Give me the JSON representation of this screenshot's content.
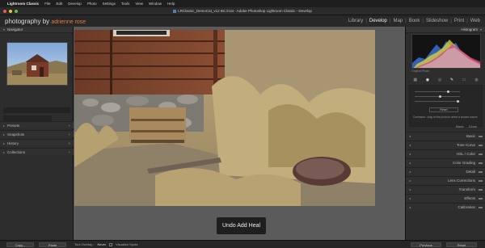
{
  "menubar": {
    "items": [
      "Lightroom Classic",
      "File",
      "Edit",
      "Develop",
      "Photo",
      "Settings",
      "Tools",
      "View",
      "Window",
      "Help"
    ]
  },
  "window": {
    "title": "LRClassic_DemoCat_v12 BC.lrcat - Adobe Photoshop Lightroom Classic - Develop"
  },
  "identity": {
    "brand_main": "photography by",
    "brand_by": "adrienne rose"
  },
  "modules": {
    "items": [
      "Library",
      "Develop",
      "Map",
      "Book",
      "Slideshow",
      "Print",
      "Web"
    ],
    "active": "Develop"
  },
  "left_panel": {
    "navigator_label": "Navigator",
    "sections": [
      "Presets",
      "Snapshots",
      "History",
      "Collections"
    ],
    "copy_button": "Copy...",
    "paste_button": "Paste"
  },
  "center": {
    "toast": "Undo Add Heal"
  },
  "right_panel": {
    "histogram_label": "Histogram",
    "original_photo_label": "Original Photo",
    "tool_reset_button": "Reset",
    "hint_text": "Command - drag on the photo to select a custom source",
    "basic_closed_labels": [
      "Basic",
      "Close"
    ],
    "sections": [
      "Basic",
      "Tone Curve",
      "HSL / Color",
      "Color Grading",
      "Detail",
      "Lens Corrections",
      "Transform",
      "Effects",
      "Calibration"
    ],
    "previous_button": "Previous",
    "reset_button": "Reset"
  },
  "bottom_bar": {
    "tool_overlay_label": "Tool Overlay :",
    "tool_overlay_value": "Never",
    "visualize_spots_label": "Visualize Spots"
  },
  "colors": {
    "module_active": "#f0f0f0",
    "brand_accent": "#e8793a",
    "panel_bg": "#2d2d2d",
    "center_bg": "#5b5b5b"
  }
}
